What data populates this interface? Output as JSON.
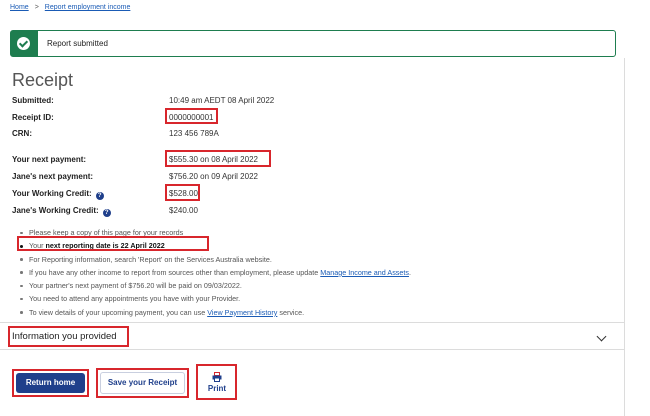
{
  "breadcrumb": {
    "home": "Home",
    "separator": ">",
    "current": "Report employment income"
  },
  "alert": {
    "message": "Report submitted"
  },
  "page_title": "Receipt",
  "details": {
    "submitted_label": "Submitted:",
    "submitted_value": "10:49 am AEDT  08 April 2022",
    "receipt_label": "Receipt ID:",
    "receipt_value": "0000000001",
    "crn_label": "CRN:",
    "crn_value": "123 456 789A",
    "next_payment_label": "Your next payment:",
    "next_payment_value": "$555.30 on  08 April 2022",
    "partner_payment_label": "Jane's next payment:",
    "partner_payment_value": "$756.20 on 09 April 2022",
    "working_credit_label": "Your Working Credit:",
    "working_credit_value": "$528.00",
    "partner_credit_label": "Jane's Working Credit:",
    "partner_credit_value": "$240.00"
  },
  "notes": {
    "n1": "Please keep a copy of this page for your records",
    "n2_prefix": "Your ",
    "n2_bold": "next reporting date is 22 April 2022",
    "n3": "For Reporting information, search 'Report' on the Services Australia website.",
    "n4_prefix": "If you have any other income to report from sources other than employment, please update ",
    "n4_link": "Manage Income and Assets",
    "n4_suffix": ".",
    "n5": "Your partner's next payment of $756.20 will be paid on 09/03/2022.",
    "n6": "You need to attend any appointments you have with your Provider.",
    "n7_prefix": "To view details of your upcoming payment, you can use ",
    "n7_link": "View Payment History",
    "n7_suffix": " service."
  },
  "accordion": {
    "title": "Information you provided"
  },
  "buttons": {
    "return_home": "Return home",
    "save_receipt": "Save your Receipt",
    "print": "Print"
  },
  "icons": {
    "alert": "check-circle-icon",
    "help": "question-circle-icon",
    "expand": "chevron-down-icon",
    "print": "printer-icon"
  },
  "colors": {
    "primary": "#1f3f8b",
    "success": "#1e7d4f",
    "highlight": "#d8262c",
    "link": "#1a5bb5"
  }
}
